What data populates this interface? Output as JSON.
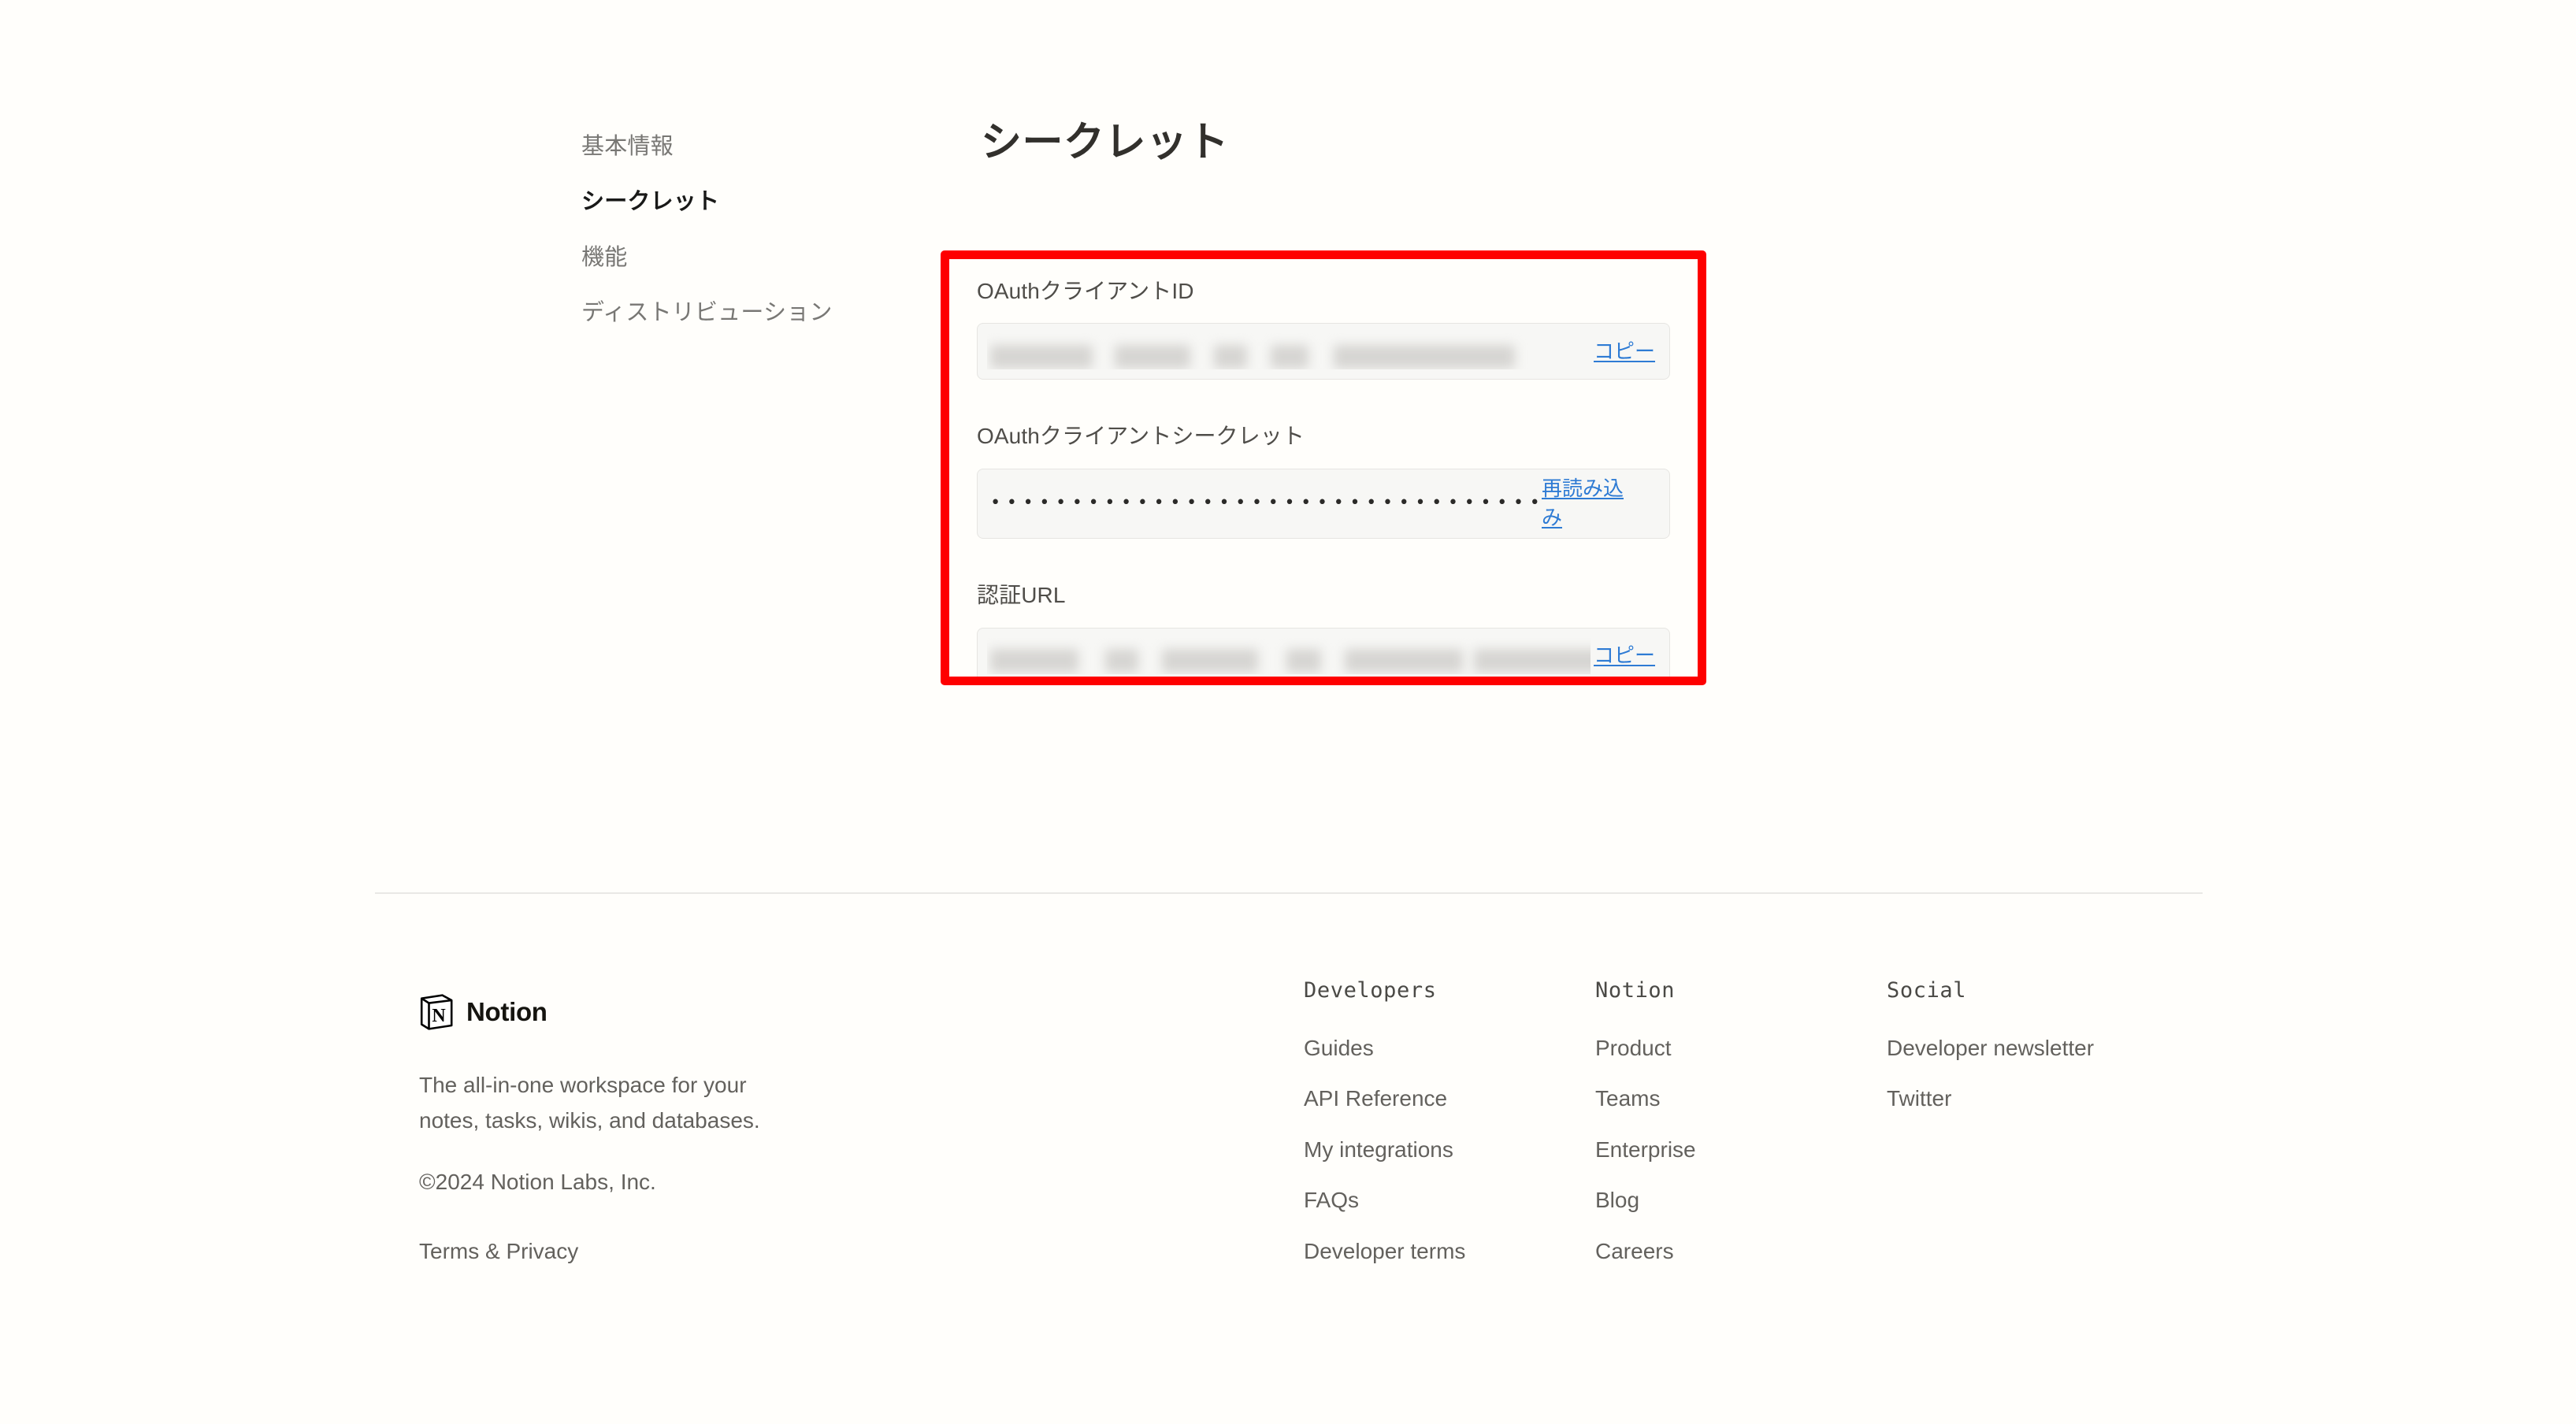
{
  "theme": {
    "background": "#fffefb",
    "accent_blue": "#2e7bd4",
    "annotation_red": "#fe0000",
    "text_primary": "#32302c",
    "text_muted": "#63615d",
    "field_bg": "#f7f7f5"
  },
  "sidebar": {
    "items": [
      {
        "label": "基本情報",
        "active": false
      },
      {
        "label": "シークレット",
        "active": true
      },
      {
        "label": "機能",
        "active": false
      },
      {
        "label": "ディストリビューション",
        "active": false
      }
    ]
  },
  "main": {
    "title": "シークレット",
    "fields": [
      {
        "label": "OAuthクライアントID",
        "value": "",
        "value_state": "redacted",
        "action_label": "コピー"
      },
      {
        "label": "OAuthクライアントシークレット",
        "value": "••••••••••••••••••••••••••••••••••••••••••",
        "value_state": "masked",
        "action_label": "再読み込み"
      },
      {
        "label": "認証URL",
        "value": "",
        "value_state": "redacted",
        "action_label": "コピー"
      }
    ]
  },
  "footer": {
    "brand_name": "Notion",
    "logo_icon": "notion-logo-icon",
    "tagline": "The all-in-one workspace for your notes, tasks, wikis, and databases.",
    "copyright": "©2024 Notion Labs, Inc.",
    "terms": "Terms & Privacy",
    "columns": [
      {
        "heading": "Developers",
        "links": [
          "Guides",
          "API Reference",
          "My integrations",
          "FAQs",
          "Developer terms"
        ]
      },
      {
        "heading": "Notion",
        "links": [
          "Product",
          "Teams",
          "Enterprise",
          "Blog",
          "Careers"
        ]
      },
      {
        "heading": "Social",
        "links": [
          "Developer newsletter",
          "Twitter"
        ]
      }
    ]
  }
}
